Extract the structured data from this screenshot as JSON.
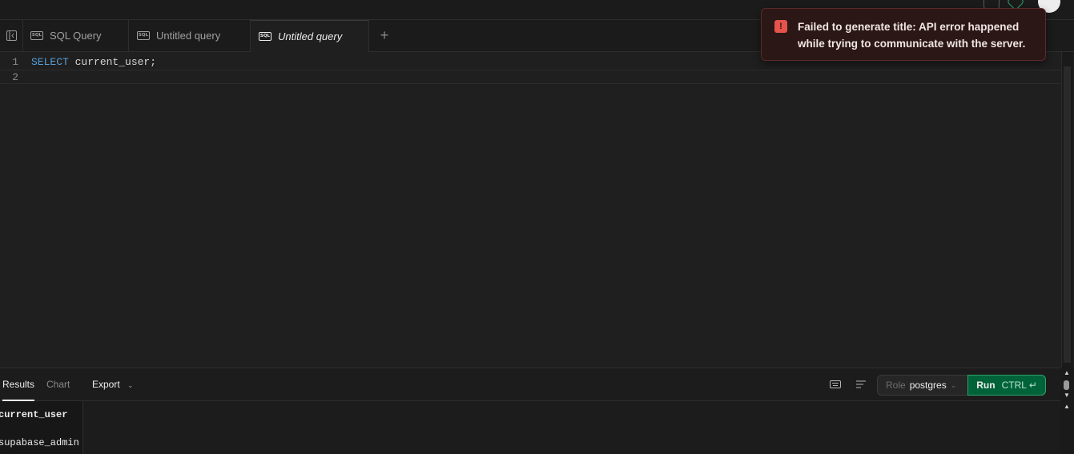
{
  "tabs": [
    {
      "label": "SQL Query",
      "icon": "sql-icon",
      "active": false
    },
    {
      "label": "Untitled query",
      "icon": "sql-icon",
      "active": false
    },
    {
      "label": "Untitled query",
      "icon": "sql-icon",
      "active": true
    }
  ],
  "editor": {
    "lines": [
      {
        "number": "1",
        "keyword": "SELECT",
        "rest": " current_user;"
      },
      {
        "number": "2",
        "keyword": "",
        "rest": ""
      }
    ]
  },
  "results": {
    "tabs": {
      "results": "Results",
      "chart": "Chart"
    },
    "export_label": "Export",
    "role_label": "Role",
    "role_value": "postgres",
    "run_label": "Run",
    "run_shortcut": "CTRL ↵",
    "columns": [
      "current_user"
    ],
    "rows": [
      [
        "supabase_admin"
      ]
    ]
  },
  "toast": {
    "message": "Failed to generate title: API error happened while trying to communicate with the server.",
    "icon": "warning-triangle-icon",
    "color": "#e5534b"
  },
  "colors": {
    "accent_green": "#006239",
    "keyword_blue": "#569cd6"
  }
}
